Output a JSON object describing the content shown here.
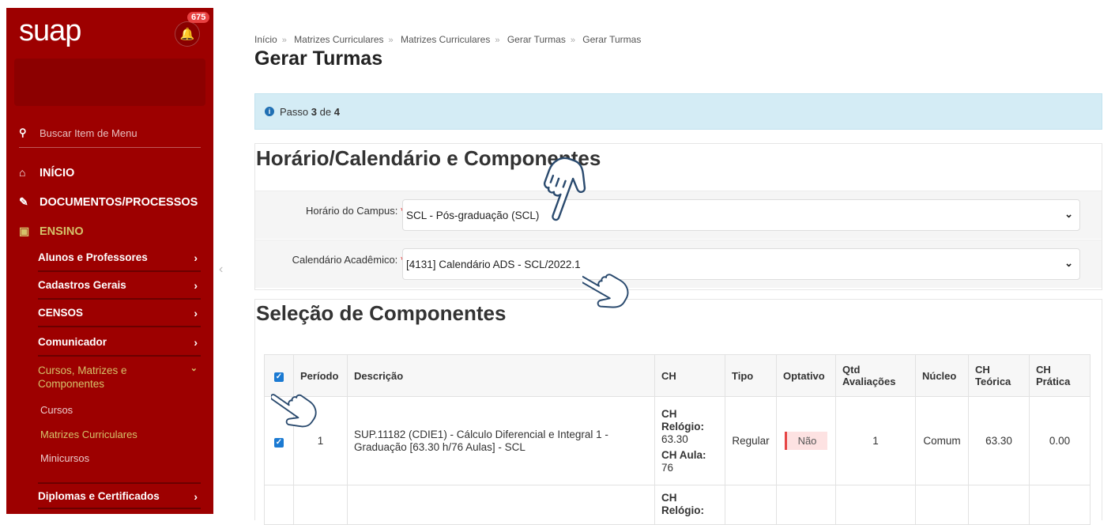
{
  "app": {
    "logo": "suap",
    "notifications": "675"
  },
  "sidebar": {
    "search_placeholder": "Buscar Item de Menu",
    "items": {
      "inicio": "INÍCIO",
      "documentos": "DOCUMENTOS/PROCESSOS",
      "ensino": "ENSINO",
      "alunos": "Alunos e Professores",
      "cadastros": "Cadastros Gerais",
      "censos": "CENSOS",
      "comunicador": "Comunicador",
      "cursos_matrizes": "Cursos, Matrizes e Componentes",
      "cursos": "Cursos",
      "matrizes": "Matrizes Curriculares",
      "minicursos": "Minicursos",
      "diplomas": "Diplomas e Certificados"
    }
  },
  "breadcrumb": [
    "Início",
    "Matrizes Curriculares",
    "Matrizes Curriculares",
    "Gerar Turmas",
    "Gerar Turmas"
  ],
  "page_title": "Gerar Turmas",
  "step": {
    "prefix": "Passo",
    "current": "3",
    "middle": "de",
    "total": "4"
  },
  "section1": {
    "title": "Horário/Calendário e Componentes",
    "horario_label": "Horário do Campus:",
    "horario_value": "SCL - Pós-graduação (SCL)",
    "calendario_label": "Calendário Acadêmico:",
    "calendario_value": "[4131] Calendário ADS - SCL/2022.1"
  },
  "section2": {
    "title": "Seleção de Componentes",
    "columns": [
      "Período",
      "Descrição",
      "CH",
      "Tipo",
      "Optativo",
      "Qtd Avaliações",
      "Núcleo",
      "CH Teórica",
      "CH Prática"
    ],
    "rows": [
      {
        "periodo": "1",
        "descricao": "SUP.11182 (CDIE1) - Cálculo Diferencial e Integral 1 - Graduação [63.30 h/76 Aulas] - SCL",
        "ch_relogio_label": "CH Relógio:",
        "ch_relogio": "63.30",
        "ch_aula_label": "CH Aula:",
        "ch_aula": "76",
        "tipo": "Regular",
        "optativo": "Não",
        "qtd_avaliacoes": "1",
        "nucleo": "Comum",
        "ch_teorica": "63.30",
        "ch_pratica": "0.00"
      },
      {
        "ch_label": "CH",
        "ch_partial": "Relógio:"
      }
    ]
  }
}
